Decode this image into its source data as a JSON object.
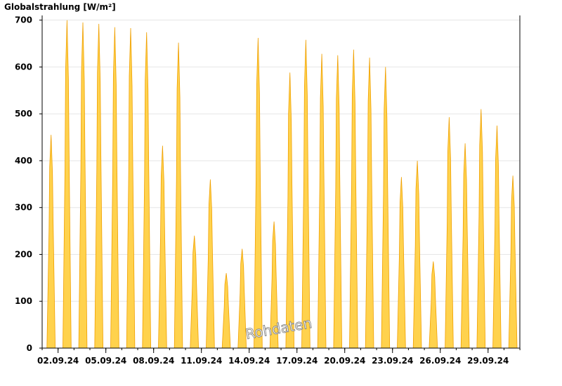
{
  "chart_data": {
    "type": "area",
    "title": "",
    "ylabel": "Globalstrahlung [W/m²]",
    "xlabel": "",
    "ylim": [
      0,
      710
    ],
    "yticks": [
      0,
      100,
      200,
      300,
      400,
      500,
      600,
      700
    ],
    "xlim": [
      "2024-09-01",
      "2024-09-30"
    ],
    "xtick_labels": [
      "02.09.24",
      "05.09.24",
      "08.09.24",
      "11.09.24",
      "14.09.24",
      "17.09.24",
      "20.09.24",
      "23.09.24",
      "26.09.24",
      "29.09.24"
    ],
    "grid": true,
    "watermark": "Rohdaten",
    "fill_color": "#FFD24D",
    "line_color": "#F0A000",
    "series": [
      {
        "daily_peaks": [
          {
            "date": "2024-09-01",
            "peak": 455
          },
          {
            "date": "2024-09-02",
            "peak": 700
          },
          {
            "date": "2024-09-03",
            "peak": 695
          },
          {
            "date": "2024-09-04",
            "peak": 692
          },
          {
            "date": "2024-09-05",
            "peak": 685
          },
          {
            "date": "2024-09-06",
            "peak": 683
          },
          {
            "date": "2024-09-07",
            "peak": 674
          },
          {
            "date": "2024-09-08",
            "peak": 432
          },
          {
            "date": "2024-09-09",
            "peak": 652
          },
          {
            "date": "2024-09-10",
            "peak": 240
          },
          {
            "date": "2024-09-11",
            "peak": 360
          },
          {
            "date": "2024-09-12",
            "peak": 160
          },
          {
            "date": "2024-09-13",
            "peak": 212
          },
          {
            "date": "2024-09-14",
            "peak": 662
          },
          {
            "date": "2024-09-15",
            "peak": 270
          },
          {
            "date": "2024-09-16",
            "peak": 588
          },
          {
            "date": "2024-09-17",
            "peak": 658
          },
          {
            "date": "2024-09-18",
            "peak": 628
          },
          {
            "date": "2024-09-19",
            "peak": 625
          },
          {
            "date": "2024-09-20",
            "peak": 637
          },
          {
            "date": "2024-09-21",
            "peak": 620
          },
          {
            "date": "2024-09-22",
            "peak": 600
          },
          {
            "date": "2024-09-23",
            "peak": 365
          },
          {
            "date": "2024-09-24",
            "peak": 400
          },
          {
            "date": "2024-09-25",
            "peak": 185
          },
          {
            "date": "2024-09-26",
            "peak": 493
          },
          {
            "date": "2024-09-27",
            "peak": 437
          },
          {
            "date": "2024-09-28",
            "peak": 510
          },
          {
            "date": "2024-09-29",
            "peak": 475
          },
          {
            "date": "2024-09-30",
            "peak": 368
          }
        ]
      }
    ]
  }
}
